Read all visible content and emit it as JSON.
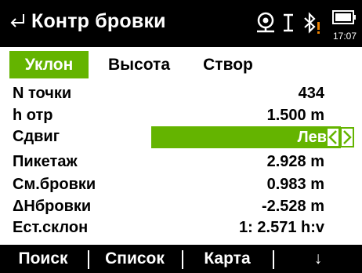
{
  "titlebar": {
    "title": "Контр бровки",
    "time": "17:07",
    "icons": [
      "back-arrow-icon",
      "prism-target-icon",
      "text-cursor-icon",
      "bluetooth-warning-icon",
      "battery-icon"
    ]
  },
  "tabs": [
    {
      "label": "Уклон",
      "active": true
    },
    {
      "label": "Высота",
      "active": false
    },
    {
      "label": "Створ",
      "active": false
    }
  ],
  "fields": {
    "point_no": {
      "label": "N точки",
      "value": "434"
    },
    "h_target": {
      "label": "h отр",
      "value": "1.500 m"
    },
    "offset": {
      "label": "Сдвиг",
      "value": "Лево"
    },
    "chainage": {
      "label": "Пикетаж",
      "value": "2.928 m"
    },
    "crest_offset": {
      "label": "См.бровки",
      "value": "0.983 m"
    },
    "dh_crest": {
      "label": "ΔНбровки",
      "value": "-2.528 m"
    },
    "natural_slope": {
      "label": "Ест.склон",
      "value": "1: 2.571 h:v"
    }
  },
  "softkeys": {
    "search": "Поиск",
    "list": "Список",
    "map": "Карта",
    "down": "↓"
  },
  "colors": {
    "accent": "#64b400",
    "bar": "#000000",
    "warning": "#e98000"
  }
}
